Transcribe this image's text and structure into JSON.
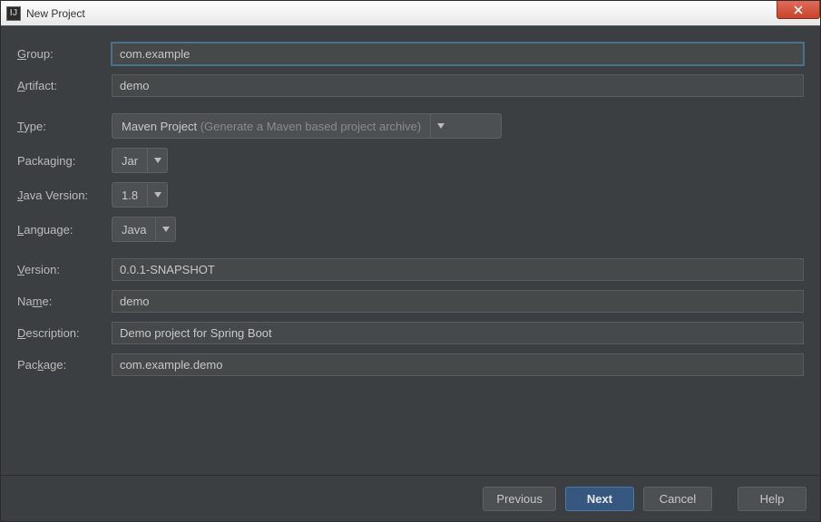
{
  "window": {
    "title": "New Project",
    "icon_label": "IJ"
  },
  "fields": {
    "group": {
      "label_pre": "G",
      "label_post": "roup:",
      "value": "com.example"
    },
    "artifact": {
      "label_pre": "A",
      "label_post": "rtifact:",
      "value": "demo"
    },
    "type": {
      "label_pre": "T",
      "label_post": "ype:",
      "value": "Maven Project",
      "hint": " (Generate a Maven based project archive)"
    },
    "packaging": {
      "label": "Packaging:",
      "value": "Jar"
    },
    "java_version": {
      "label_pre": "J",
      "label_post": "ava Version:",
      "value": "1.8"
    },
    "language": {
      "label_pre": "L",
      "label_post": "anguage:",
      "value": "Java"
    },
    "version": {
      "label_pre": "V",
      "label_post": "ersion:",
      "value": "0.0.1-SNAPSHOT"
    },
    "name": {
      "label_pre": "Na",
      "label_ul": "m",
      "label_post": "e:",
      "value": "demo"
    },
    "description": {
      "label_pre": "D",
      "label_post": "escription:",
      "value": "Demo project for Spring Boot"
    },
    "package": {
      "label_pre": "Pac",
      "label_ul": "k",
      "label_post": "age:",
      "value": "com.example.demo"
    }
  },
  "buttons": {
    "previous": "Previous",
    "next": "Next",
    "cancel": "Cancel",
    "help": "Help"
  }
}
